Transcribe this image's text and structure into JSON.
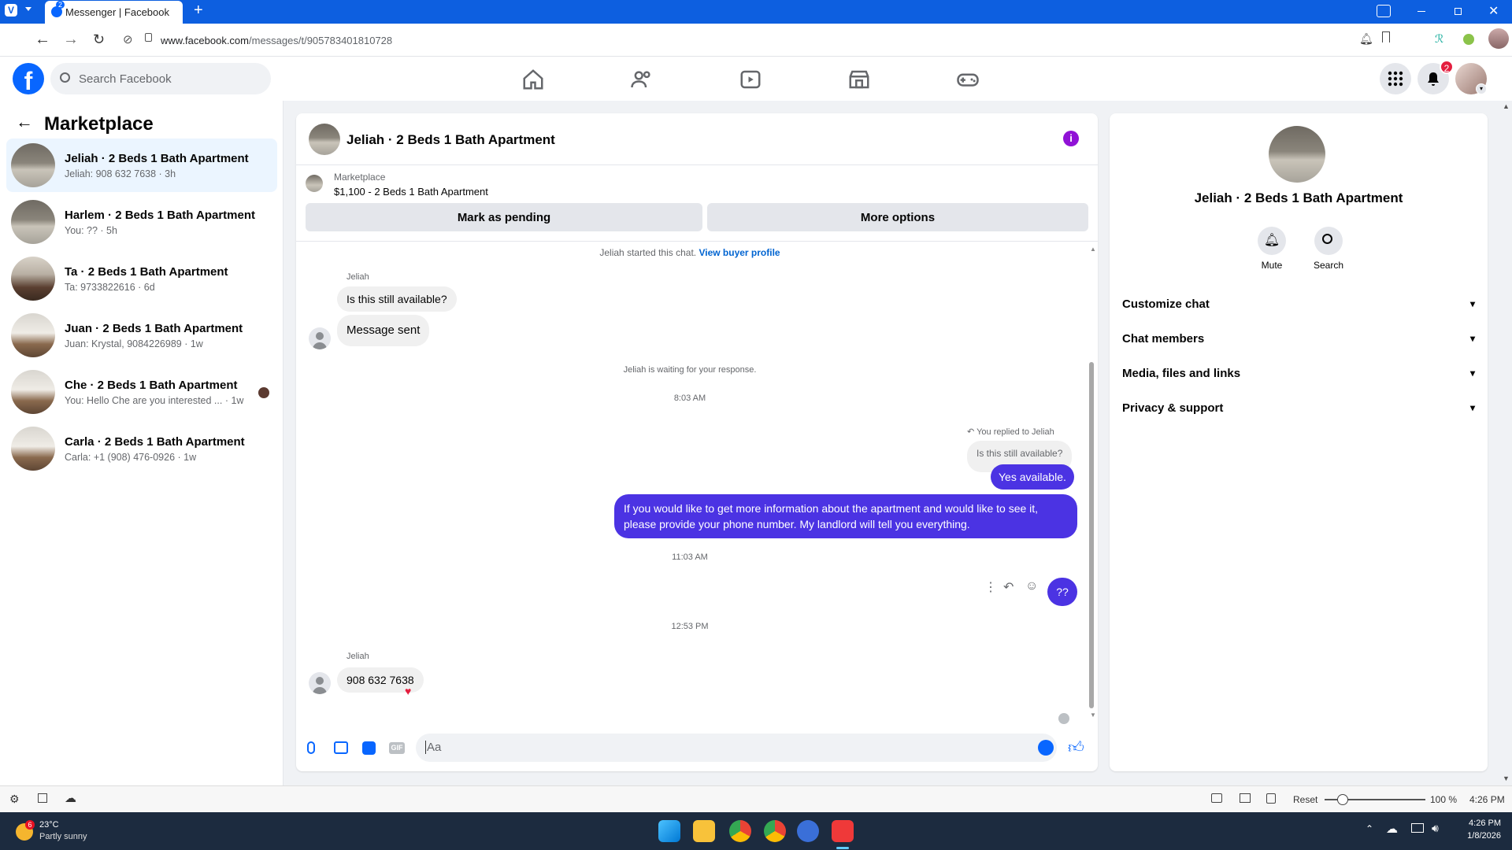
{
  "browser": {
    "tab_title": "Messenger | Facebook",
    "tab_badge": "2",
    "url_host": "www.facebook.com",
    "url_path": "/messages/t/905783401810728"
  },
  "header": {
    "search_placeholder": "Search Facebook",
    "notification_count": "2"
  },
  "sidebar": {
    "title": "Marketplace",
    "conversations": [
      {
        "name": "Jeliah · 2 Beds 1 Bath Apartment",
        "preview": "Jeliah: 908 632 7638 · 3h"
      },
      {
        "name": "Harlem · 2 Beds 1 Bath Apartment",
        "preview": "You: ?? · 5h"
      },
      {
        "name": "Ta · 2 Beds 1 Bath Apartment",
        "preview": "Ta: 9733822616 · 6d"
      },
      {
        "name": "Juan · 2 Beds 1 Bath Apartment",
        "preview": "Juan: Krystal, 9084226989 · 1w"
      },
      {
        "name": "Che · 2 Beds 1 Bath Apartment",
        "preview": "You: Hello Che are you interested ... · 1w"
      },
      {
        "name": "Carla · 2 Beds 1 Bath Apartment",
        "preview": "Carla: +1 (908) 476-0926 · 1w"
      }
    ]
  },
  "chat": {
    "title": "Jeliah · 2 Beds 1 Bath Apartment",
    "listing_source": "Marketplace",
    "listing_title": "$1,100 - 2 Beds 1 Bath Apartment",
    "mark_pending_label": "Mark as pending",
    "more_options_label": "More options",
    "started_text": "Jeliah started this chat.",
    "view_buyer_profile": "View buyer profile",
    "sender_name": "Jeliah",
    "msg1": "Is this still available?",
    "msg2": "Message sent",
    "waiting_text": "Jeliah is waiting for your response.",
    "time1": "8:03 AM",
    "replied_to": "You replied to Jeliah",
    "quoted": "Is this still available?",
    "reply1": "Yes available.",
    "reply2": "If you would like to get more information about the apartment and would like to see it, please provide your phone number. My landlord will tell you everything.",
    "time2": "11:03 AM",
    "reply3": "??",
    "time3": "12:53 PM",
    "msg3": "908 632 7638",
    "composer_placeholder": "Aa"
  },
  "details": {
    "name": "Jeliah · 2 Beds 1 Bath Apartment",
    "mute_label": "Mute",
    "search_label": "Search",
    "sections": [
      "Customize chat",
      "Chat members",
      "Media, files and links",
      "Privacy & support"
    ]
  },
  "statusbar": {
    "reset_label": "Reset",
    "zoom": "100 %",
    "time": "4:26 PM"
  },
  "taskbar": {
    "temp": "23°C",
    "weather": "Partly sunny",
    "weather_badge": "6",
    "time": "4:26 PM",
    "date": "1/8/2026"
  },
  "colors": {
    "fb_blue": "#0866ff",
    "messenger_purple": "#4b33e3",
    "browser_bar": "#0d5fe0"
  }
}
